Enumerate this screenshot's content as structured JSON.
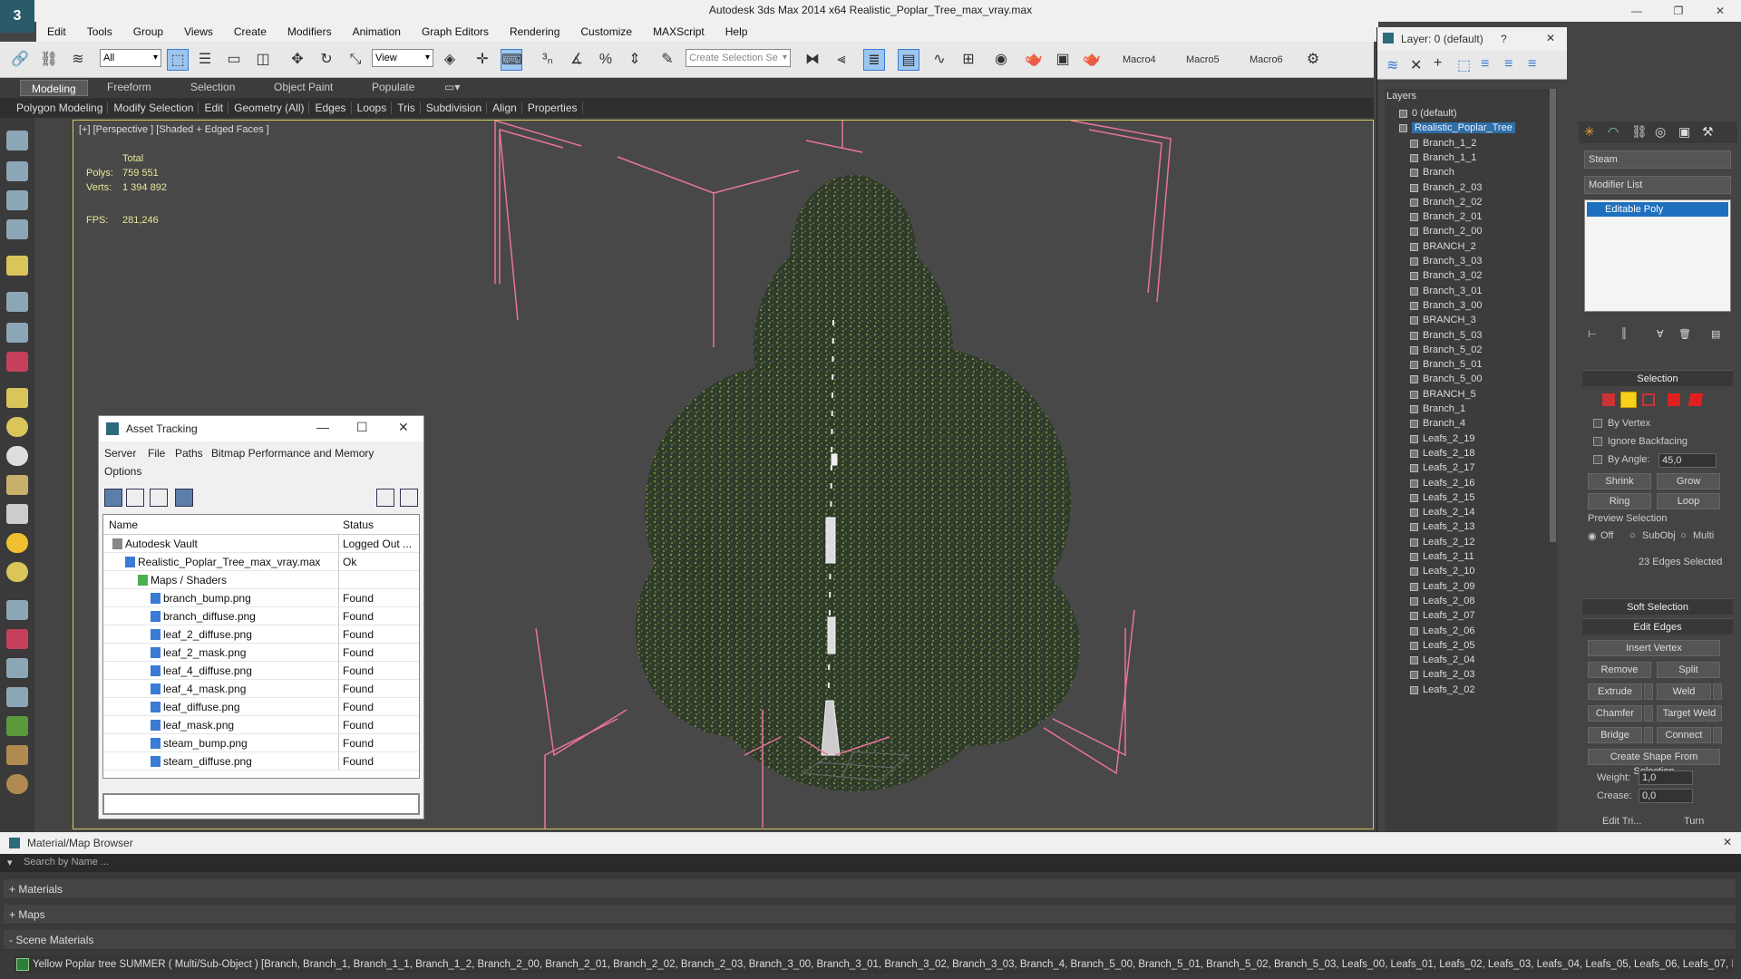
{
  "app": {
    "title": "Autodesk 3ds Max  2014 x64     Realistic_Poplar_Tree_max_vray.max"
  },
  "menu": [
    "Edit",
    "Tools",
    "Group",
    "Views",
    "Create",
    "Modifiers",
    "Animation",
    "Graph Editors",
    "Rendering",
    "Customize",
    "MAXScript",
    "Help"
  ],
  "toolbar": {
    "filter_value": "All",
    "ref_coord_value": "View",
    "selection_set_placeholder": "Create Selection Se",
    "macros": [
      "Macro4",
      "Macro5",
      "Macro6"
    ]
  },
  "ribbon": {
    "tabs": [
      "Modeling",
      "Freeform",
      "Selection",
      "Object Paint",
      "Populate"
    ],
    "sub": [
      "Polygon Modeling",
      "Modify Selection",
      "Edit",
      "Geometry (All)",
      "Edges",
      "Loops",
      "Tris",
      "Subdivision",
      "Align",
      "Properties"
    ]
  },
  "viewport": {
    "label": "[+] [Perspective ] [Shaded + Edged Faces ]",
    "total_label": "Total",
    "polys_label": "Polys:",
    "polys_value": "759 551",
    "verts_label": "Verts:",
    "verts_value": "1 394 892",
    "fps_label": "FPS:",
    "fps_value": "281,246"
  },
  "asset_tracking": {
    "title": "Asset Tracking",
    "menu": [
      "Server",
      "File",
      "Paths",
      "Bitmap Performance and Memory",
      "Options"
    ],
    "columns": [
      "Name",
      "Status"
    ],
    "rows": [
      {
        "name": "Autodesk Vault",
        "status": "Logged Out ...",
        "indent": 0,
        "kind": "vault"
      },
      {
        "name": "Realistic_Poplar_Tree_max_vray.max",
        "status": "Ok",
        "indent": 1,
        "kind": "max"
      },
      {
        "name": "Maps / Shaders",
        "status": "",
        "indent": 2,
        "kind": "folder"
      },
      {
        "name": "branch_bump.png",
        "status": "Found",
        "indent": 3,
        "kind": "file"
      },
      {
        "name": "branch_diffuse.png",
        "status": "Found",
        "indent": 3,
        "kind": "file"
      },
      {
        "name": "leaf_2_diffuse.png",
        "status": "Found",
        "indent": 3,
        "kind": "file"
      },
      {
        "name": "leaf_2_mask.png",
        "status": "Found",
        "indent": 3,
        "kind": "file"
      },
      {
        "name": "leaf_4_diffuse.png",
        "status": "Found",
        "indent": 3,
        "kind": "file"
      },
      {
        "name": "leaf_4_mask.png",
        "status": "Found",
        "indent": 3,
        "kind": "file"
      },
      {
        "name": "leaf_diffuse.png",
        "status": "Found",
        "indent": 3,
        "kind": "file"
      },
      {
        "name": "leaf_mask.png",
        "status": "Found",
        "indent": 3,
        "kind": "file"
      },
      {
        "name": "steam_bump.png",
        "status": "Found",
        "indent": 3,
        "kind": "file"
      },
      {
        "name": "steam_diffuse.png",
        "status": "Found",
        "indent": 3,
        "kind": "file"
      }
    ]
  },
  "layer_window": {
    "title": "Layer: 0 (default)",
    "help": "?",
    "header": "Layers",
    "items": [
      {
        "label": "0 (default)",
        "level": 0,
        "selected": false
      },
      {
        "label": "Realistic_Poplar_Tree",
        "level": 0,
        "selected": true
      },
      {
        "label": "Branch_1_2",
        "level": 1
      },
      {
        "label": "Branch_1_1",
        "level": 1
      },
      {
        "label": "Branch",
        "level": 1
      },
      {
        "label": "Branch_2_03",
        "level": 1
      },
      {
        "label": "Branch_2_02",
        "level": 1
      },
      {
        "label": "Branch_2_01",
        "level": 1
      },
      {
        "label": "Branch_2_00",
        "level": 1
      },
      {
        "label": "BRANCH_2",
        "level": 1
      },
      {
        "label": "Branch_3_03",
        "level": 1
      },
      {
        "label": "Branch_3_02",
        "level": 1
      },
      {
        "label": "Branch_3_01",
        "level": 1
      },
      {
        "label": "Branch_3_00",
        "level": 1
      },
      {
        "label": "BRANCH_3",
        "level": 1
      },
      {
        "label": "Branch_5_03",
        "level": 1
      },
      {
        "label": "Branch_5_02",
        "level": 1
      },
      {
        "label": "Branch_5_01",
        "level": 1
      },
      {
        "label": "Branch_5_00",
        "level": 1
      },
      {
        "label": "BRANCH_5",
        "level": 1
      },
      {
        "label": "Branch_1",
        "level": 1
      },
      {
        "label": "Branch_4",
        "level": 1
      },
      {
        "label": "Leafs_2_19",
        "level": 1
      },
      {
        "label": "Leafs_2_18",
        "level": 1
      },
      {
        "label": "Leafs_2_17",
        "level": 1
      },
      {
        "label": "Leafs_2_16",
        "level": 1
      },
      {
        "label": "Leafs_2_15",
        "level": 1
      },
      {
        "label": "Leafs_2_14",
        "level": 1
      },
      {
        "label": "Leafs_2_13",
        "level": 1
      },
      {
        "label": "Leafs_2_12",
        "level": 1
      },
      {
        "label": "Leafs_2_11",
        "level": 1
      },
      {
        "label": "Leafs_2_10",
        "level": 1
      },
      {
        "label": "Leafs_2_09",
        "level": 1
      },
      {
        "label": "Leafs_2_08",
        "level": 1
      },
      {
        "label": "Leafs_2_07",
        "level": 1
      },
      {
        "label": "Leafs_2_06",
        "level": 1
      },
      {
        "label": "Leafs_2_05",
        "level": 1
      },
      {
        "label": "Leafs_2_04",
        "level": 1
      },
      {
        "label": "Leafs_2_03",
        "level": 1
      },
      {
        "label": "Leafs_2_02",
        "level": 1
      }
    ]
  },
  "command_panel": {
    "object_name": "Steam",
    "modifier_list": "Modifier List",
    "stack_item": "Editable Poly",
    "selection_title": "Selection",
    "by_vertex": "By Vertex",
    "ignore_backfacing": "Ignore Backfacing",
    "by_angle": "By Angle:",
    "by_angle_value": "45,0",
    "shrink": "Shrink",
    "grow": "Grow",
    "ring": "Ring",
    "loop": "Loop",
    "preview_selection": "Preview Selection",
    "preview_off": "Off",
    "preview_subobj": "SubObj",
    "preview_multi": "Multi",
    "selected_info": "23 Edges Selected",
    "soft_selection": "Soft Selection",
    "edit_edges": "Edit Edges",
    "insert_vertex": "Insert Vertex",
    "remove": "Remove",
    "split": "Split",
    "extrude": "Extrude",
    "weld": "Weld",
    "chamfer": "Chamfer",
    "target_weld": "Target Weld",
    "bridge": "Bridge",
    "connect": "Connect",
    "create_shape": "Create Shape From Selection",
    "weight_label": "Weight:",
    "weight_value": "1,0",
    "crease_label": "Crease:",
    "crease_value": "0,0",
    "edit_tri": "Edit Tri...",
    "turn": "Turn"
  },
  "material_browser": {
    "title": "Material/Map Browser",
    "search_placeholder": "Search by Name ...",
    "sections": [
      "+ Materials",
      "+ Maps",
      "- Scene Materials"
    ],
    "scene_material": "Yellow Poplar tree SUMMER  ( Multi/Sub-Object )  [Branch, Branch_1, Branch_1_1, Branch_1_2, Branch_2_00, Branch_2_01, Branch_2_02, Branch_2_03, Branch_3_00, Branch_3_01, Branch_3_02, Branch_3_03, Branch_4, Branch_5_00, Branch_5_01, Branch_5_02, Branch_5_03, Leafs_00, Leafs_01, Leafs_02, Leafs_03, Leafs_04, Leafs_05, Leafs_06, Leafs_07, Leafs..."
  },
  "colors": {
    "selection_bracket": "#e8749a",
    "layer_selected": "#2f6fa8",
    "stack_selected": "#1f6fbf",
    "viewport_border": "#d6c95a",
    "stats_text": "#e8e89a"
  }
}
